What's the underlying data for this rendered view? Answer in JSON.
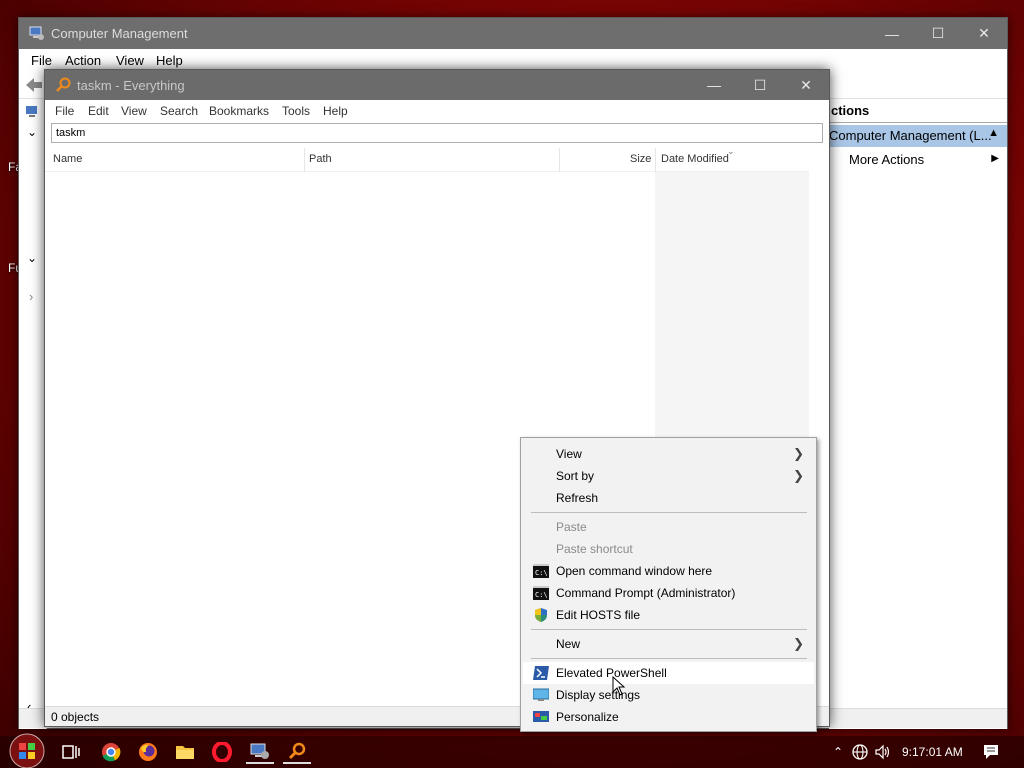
{
  "desktop": {
    "labels": [
      "Fa",
      "Fu"
    ]
  },
  "cm": {
    "title": "Computer Management",
    "menu": [
      "File",
      "Action",
      "View",
      "Help"
    ],
    "actions_header": "ctions",
    "actions_selected": "Computer Management (L...",
    "actions_more": "More Actions"
  },
  "everything": {
    "title": "taskm - Everything",
    "menu": [
      "File",
      "Edit",
      "View",
      "Search",
      "Bookmarks",
      "Tools",
      "Help"
    ],
    "search_value": "taskm",
    "columns": [
      "Name",
      "Path",
      "Size",
      "Date Modified"
    ],
    "status": "0 objects"
  },
  "context_menu": {
    "items": [
      {
        "label": "View",
        "submenu": true
      },
      {
        "label": "Sort by",
        "submenu": true
      },
      {
        "label": "Refresh"
      },
      {
        "label": "Paste",
        "disabled": true
      },
      {
        "label": "Paste shortcut",
        "disabled": true
      },
      {
        "label": "Open command window here",
        "icon": "cmd-icon"
      },
      {
        "label": "Command Prompt (Administrator)",
        "icon": "cmd-icon"
      },
      {
        "label": "Edit HOSTS file",
        "icon": "shield-icon"
      },
      {
        "label": "New",
        "submenu": true
      },
      {
        "label": "Elevated PowerShell",
        "icon": "powershell-icon"
      },
      {
        "label": "Display settings",
        "icon": "display-icon"
      },
      {
        "label": "Personalize",
        "icon": "personalize-icon"
      }
    ]
  },
  "taskbar": {
    "clock": "9:17:01 AM",
    "apps": [
      "task-view-icon",
      "chrome-icon",
      "firefox-icon",
      "file-explorer-icon",
      "opera-icon",
      "computer-management-icon",
      "everything-icon"
    ]
  },
  "colors": {
    "desktop_red": "#9a0a0a",
    "actions_highlight": "#a9c6e6",
    "titlebar_inactive": "#6e6e6e"
  }
}
